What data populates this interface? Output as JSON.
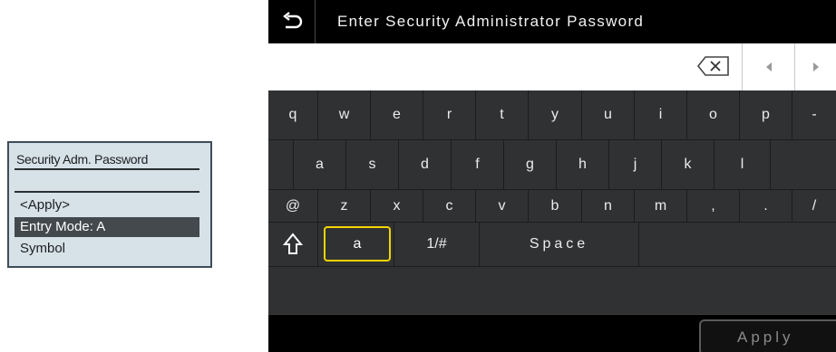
{
  "lcd": {
    "title": "Security Adm. Password",
    "items": [
      "<Apply>",
      "Entry Mode: A",
      "Symbol"
    ]
  },
  "panel": {
    "title": "Enter Security Administrator Password",
    "icons": {
      "back": "back-arrow-icon",
      "backspace": "backspace-icon",
      "cursor_left": "cursor-left-icon",
      "cursor_right": "cursor-right-icon",
      "shift": "shift-icon"
    },
    "password_value": ""
  },
  "keyboard": {
    "row1": [
      "q",
      "w",
      "e",
      "r",
      "t",
      "y",
      "u",
      "i",
      "o",
      "p",
      "-"
    ],
    "row2": [
      "a",
      "s",
      "d",
      "f",
      "g",
      "h",
      "j",
      "k",
      "l",
      ""
    ],
    "row3": [
      "@",
      "z",
      "x",
      "c",
      "v",
      "b",
      "n",
      "m",
      ",",
      ".",
      "/"
    ],
    "row4": {
      "mode_a": "a",
      "mode_symbol": "1/#",
      "space": "Space"
    }
  },
  "footer": {
    "apply_label": "Apply"
  },
  "colors": {
    "highlight": "#f2d400",
    "lcd_background": "#d6e1e8",
    "panel_background": "#2e2f31"
  }
}
